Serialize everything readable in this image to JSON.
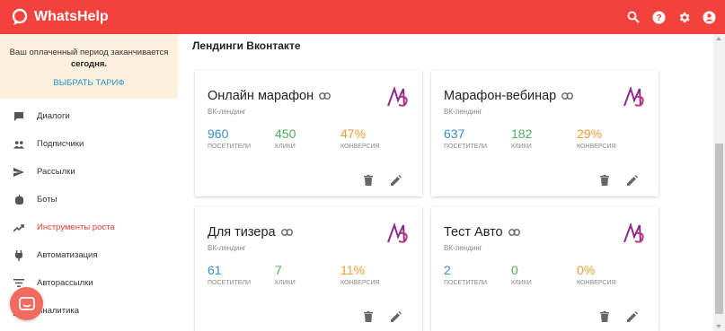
{
  "app": {
    "name": "WhatsHelp"
  },
  "topbar": {
    "icons": [
      "search-icon",
      "help-icon",
      "gear-icon",
      "account-icon"
    ]
  },
  "notice": {
    "text": "Ваш оплаченный период заканчивается",
    "bold": "сегодня.",
    "cta": "Выбрать тариф"
  },
  "nav": [
    {
      "label": "Диалоги",
      "icon": "chat-icon"
    },
    {
      "label": "Подписчики",
      "icon": "people-icon"
    },
    {
      "label": "Рассылки",
      "icon": "send-icon"
    },
    {
      "label": "Боты",
      "icon": "bot-icon"
    },
    {
      "label": "Инструменты роста",
      "icon": "trending-up-icon",
      "active": true
    },
    {
      "label": "Автоматизация",
      "icon": "plug-icon"
    },
    {
      "label": "Авторассылки",
      "icon": "filter-list-icon"
    },
    {
      "label": "Аналитика",
      "icon": "analytics-icon"
    }
  ],
  "main": {
    "title": "Лендинги Вконтакте",
    "cards": [
      {
        "title": "Онлайн марафон",
        "subtitle": "ВК-лендинг",
        "stats": [
          {
            "value": "960",
            "label": "Посетители"
          },
          {
            "value": "450",
            "label": "Клики"
          },
          {
            "value": "47%",
            "label": "Конверсия"
          }
        ]
      },
      {
        "title": "Марафон-вебинар",
        "subtitle": "ВК-лендинг",
        "stats": [
          {
            "value": "637",
            "label": "Посетители"
          },
          {
            "value": "182",
            "label": "Клики"
          },
          {
            "value": "29%",
            "label": "Конверсия"
          }
        ]
      },
      {
        "title": "Для тизера",
        "subtitle": "ВК-лендинг",
        "stats": [
          {
            "value": "61",
            "label": "Посетители"
          },
          {
            "value": "7",
            "label": "Клики"
          },
          {
            "value": "11%",
            "label": "Конверсия"
          }
        ]
      },
      {
        "title": "Тест Авто",
        "subtitle": "ВК-лендинг",
        "stats": [
          {
            "value": "2",
            "label": "Посетители"
          },
          {
            "value": "0",
            "label": "Клики"
          },
          {
            "value": "0%",
            "label": "Конверсия"
          }
        ]
      }
    ]
  },
  "colors": {
    "brand": "#f3413c",
    "active": "#e5403a",
    "link": "#2196c7",
    "visitors": "#3a8fcc",
    "clicks": "#4fae5a",
    "conversion": "#f29a33",
    "logo": "#8e2a8a"
  }
}
